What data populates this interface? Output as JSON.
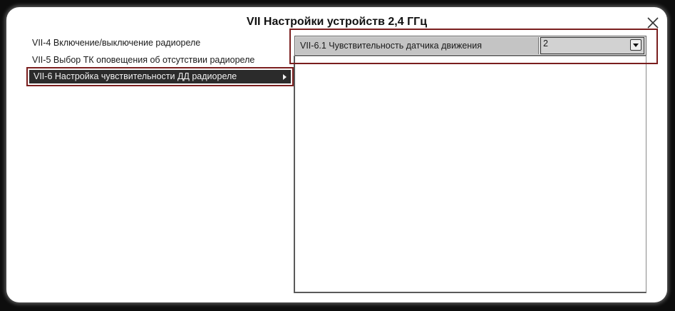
{
  "dialog": {
    "title": "VII Настройки устройств 2,4 ГГц",
    "close_icon": "close-icon"
  },
  "menu": {
    "items": [
      {
        "label": "VII-4 Включение/выключение радиореле",
        "selected": false
      },
      {
        "label": "VII-5 Выбор ТК оповещения об отсутствии радиореле",
        "selected": false
      },
      {
        "label": "VII-6 Настройка чувствительности ДД радиореле",
        "selected": true,
        "icon": "chevron-right-icon"
      }
    ]
  },
  "settings": {
    "rows": [
      {
        "label": "VII-6.1  Чувствительность датчика движения",
        "value": "2",
        "dropdown_icon": "chevron-down-icon"
      }
    ]
  },
  "colors": {
    "highlight_border": "#7a1e1e",
    "selected_bg": "#2b2b2b",
    "row_bg": "#c4c4c4"
  }
}
